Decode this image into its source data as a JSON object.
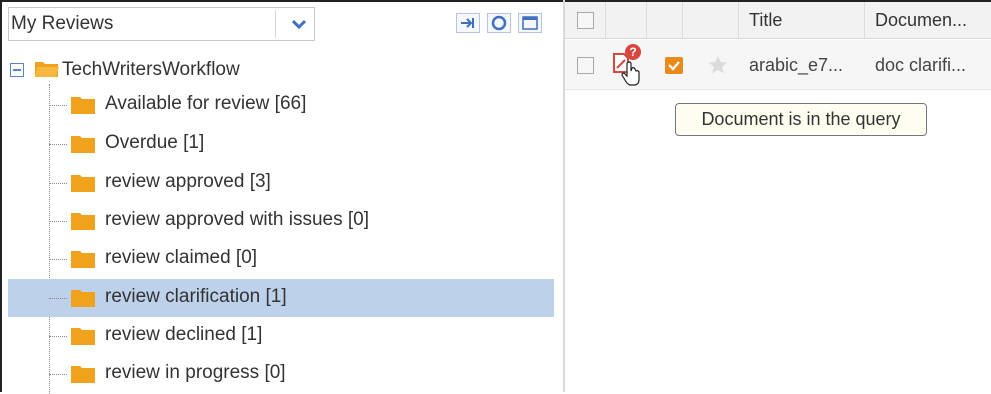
{
  "left_panel": {
    "view_select": {
      "value": "My Reviews"
    },
    "toolbar": {
      "icons": [
        "pin-icon",
        "refresh-icon",
        "window-icon"
      ]
    },
    "tree": {
      "root": {
        "label": "TechWritersWorkflow"
      },
      "items": [
        {
          "label": "Available for review [66]",
          "selected": false
        },
        {
          "label": "Overdue [1]",
          "selected": false
        },
        {
          "label": "review approved [3]",
          "selected": false
        },
        {
          "label": "review approved with issues [0]",
          "selected": false
        },
        {
          "label": "review claimed [0]",
          "selected": false
        },
        {
          "label": "review clarification [1]",
          "selected": true
        },
        {
          "label": "review declined [1]",
          "selected": false
        },
        {
          "label": "review in progress [0]",
          "selected": false
        }
      ]
    }
  },
  "grid": {
    "columns": [
      "Title",
      "Documen..."
    ],
    "rows": [
      {
        "title": "arabic_e7...",
        "document": "doc clarifi..."
      }
    ]
  },
  "tooltip": {
    "text": "Document is in the query"
  },
  "colors": {
    "selection": "#bdd1ea",
    "folder": "#f0a21d",
    "accent_blue": "#5a84c6",
    "pdf_red": "#d9463d",
    "task_orange": "#e98b1c"
  }
}
